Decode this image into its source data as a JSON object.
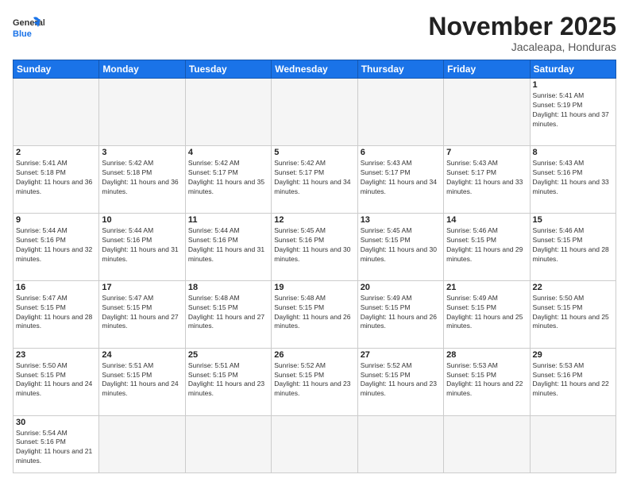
{
  "header": {
    "logo_general": "General",
    "logo_blue": "Blue",
    "month_title": "November 2025",
    "location": "Jacaleapa, Honduras"
  },
  "weekdays": [
    "Sunday",
    "Monday",
    "Tuesday",
    "Wednesday",
    "Thursday",
    "Friday",
    "Saturday"
  ],
  "weeks": [
    [
      null,
      null,
      null,
      null,
      null,
      null,
      {
        "day": "1",
        "sunrise": "Sunrise: 5:41 AM",
        "sunset": "Sunset: 5:19 PM",
        "daylight": "Daylight: 11 hours and 37 minutes."
      }
    ],
    [
      {
        "day": "2",
        "sunrise": "Sunrise: 5:41 AM",
        "sunset": "Sunset: 5:18 PM",
        "daylight": "Daylight: 11 hours and 36 minutes."
      },
      {
        "day": "3",
        "sunrise": "Sunrise: 5:42 AM",
        "sunset": "Sunset: 5:18 PM",
        "daylight": "Daylight: 11 hours and 36 minutes."
      },
      {
        "day": "4",
        "sunrise": "Sunrise: 5:42 AM",
        "sunset": "Sunset: 5:17 PM",
        "daylight": "Daylight: 11 hours and 35 minutes."
      },
      {
        "day": "5",
        "sunrise": "Sunrise: 5:42 AM",
        "sunset": "Sunset: 5:17 PM",
        "daylight": "Daylight: 11 hours and 34 minutes."
      },
      {
        "day": "6",
        "sunrise": "Sunrise: 5:43 AM",
        "sunset": "Sunset: 5:17 PM",
        "daylight": "Daylight: 11 hours and 34 minutes."
      },
      {
        "day": "7",
        "sunrise": "Sunrise: 5:43 AM",
        "sunset": "Sunset: 5:17 PM",
        "daylight": "Daylight: 11 hours and 33 minutes."
      },
      {
        "day": "8",
        "sunrise": "Sunrise: 5:43 AM",
        "sunset": "Sunset: 5:16 PM",
        "daylight": "Daylight: 11 hours and 33 minutes."
      }
    ],
    [
      {
        "day": "9",
        "sunrise": "Sunrise: 5:44 AM",
        "sunset": "Sunset: 5:16 PM",
        "daylight": "Daylight: 11 hours and 32 minutes."
      },
      {
        "day": "10",
        "sunrise": "Sunrise: 5:44 AM",
        "sunset": "Sunset: 5:16 PM",
        "daylight": "Daylight: 11 hours and 31 minutes."
      },
      {
        "day": "11",
        "sunrise": "Sunrise: 5:44 AM",
        "sunset": "Sunset: 5:16 PM",
        "daylight": "Daylight: 11 hours and 31 minutes."
      },
      {
        "day": "12",
        "sunrise": "Sunrise: 5:45 AM",
        "sunset": "Sunset: 5:16 PM",
        "daylight": "Daylight: 11 hours and 30 minutes."
      },
      {
        "day": "13",
        "sunrise": "Sunrise: 5:45 AM",
        "sunset": "Sunset: 5:15 PM",
        "daylight": "Daylight: 11 hours and 30 minutes."
      },
      {
        "day": "14",
        "sunrise": "Sunrise: 5:46 AM",
        "sunset": "Sunset: 5:15 PM",
        "daylight": "Daylight: 11 hours and 29 minutes."
      },
      {
        "day": "15",
        "sunrise": "Sunrise: 5:46 AM",
        "sunset": "Sunset: 5:15 PM",
        "daylight": "Daylight: 11 hours and 28 minutes."
      }
    ],
    [
      {
        "day": "16",
        "sunrise": "Sunrise: 5:47 AM",
        "sunset": "Sunset: 5:15 PM",
        "daylight": "Daylight: 11 hours and 28 minutes."
      },
      {
        "day": "17",
        "sunrise": "Sunrise: 5:47 AM",
        "sunset": "Sunset: 5:15 PM",
        "daylight": "Daylight: 11 hours and 27 minutes."
      },
      {
        "day": "18",
        "sunrise": "Sunrise: 5:48 AM",
        "sunset": "Sunset: 5:15 PM",
        "daylight": "Daylight: 11 hours and 27 minutes."
      },
      {
        "day": "19",
        "sunrise": "Sunrise: 5:48 AM",
        "sunset": "Sunset: 5:15 PM",
        "daylight": "Daylight: 11 hours and 26 minutes."
      },
      {
        "day": "20",
        "sunrise": "Sunrise: 5:49 AM",
        "sunset": "Sunset: 5:15 PM",
        "daylight": "Daylight: 11 hours and 26 minutes."
      },
      {
        "day": "21",
        "sunrise": "Sunrise: 5:49 AM",
        "sunset": "Sunset: 5:15 PM",
        "daylight": "Daylight: 11 hours and 25 minutes."
      },
      {
        "day": "22",
        "sunrise": "Sunrise: 5:50 AM",
        "sunset": "Sunset: 5:15 PM",
        "daylight": "Daylight: 11 hours and 25 minutes."
      }
    ],
    [
      {
        "day": "23",
        "sunrise": "Sunrise: 5:50 AM",
        "sunset": "Sunset: 5:15 PM",
        "daylight": "Daylight: 11 hours and 24 minutes."
      },
      {
        "day": "24",
        "sunrise": "Sunrise: 5:51 AM",
        "sunset": "Sunset: 5:15 PM",
        "daylight": "Daylight: 11 hours and 24 minutes."
      },
      {
        "day": "25",
        "sunrise": "Sunrise: 5:51 AM",
        "sunset": "Sunset: 5:15 PM",
        "daylight": "Daylight: 11 hours and 23 minutes."
      },
      {
        "day": "26",
        "sunrise": "Sunrise: 5:52 AM",
        "sunset": "Sunset: 5:15 PM",
        "daylight": "Daylight: 11 hours and 23 minutes."
      },
      {
        "day": "27",
        "sunrise": "Sunrise: 5:52 AM",
        "sunset": "Sunset: 5:15 PM",
        "daylight": "Daylight: 11 hours and 23 minutes."
      },
      {
        "day": "28",
        "sunrise": "Sunrise: 5:53 AM",
        "sunset": "Sunset: 5:15 PM",
        "daylight": "Daylight: 11 hours and 22 minutes."
      },
      {
        "day": "29",
        "sunrise": "Sunrise: 5:53 AM",
        "sunset": "Sunset: 5:16 PM",
        "daylight": "Daylight: 11 hours and 22 minutes."
      }
    ],
    [
      {
        "day": "30",
        "sunrise": "Sunrise: 5:54 AM",
        "sunset": "Sunset: 5:16 PM",
        "daylight": "Daylight: 11 hours and 21 minutes."
      },
      null,
      null,
      null,
      null,
      null,
      null
    ]
  ]
}
